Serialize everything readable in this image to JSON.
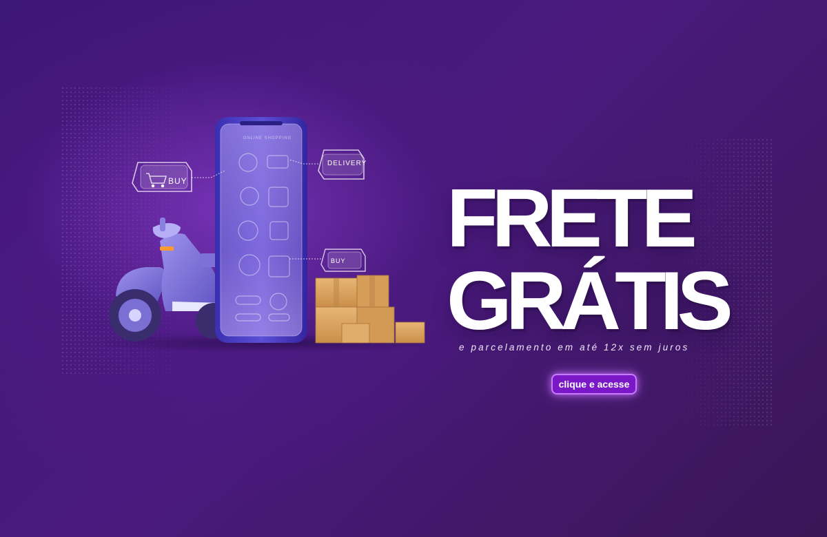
{
  "banner": {
    "headline_line1": "FRETE",
    "headline_line2": "GRÁTIS",
    "subheadline": "e parcelamento em até 12x sem juros",
    "cta_label": "clique e acesse"
  },
  "illustration": {
    "tag_buy_top": "BUY",
    "tag_delivery": "DELIVERY",
    "tag_buy_bottom": "BUY",
    "phone_heading": "ONLINE SHOPPING"
  },
  "colors": {
    "background": "#451a7e",
    "headline": "#ffffff",
    "cta_background": "#7a18c8",
    "cta_glow": "#c77bff",
    "scooter": "#7f74d6",
    "box": "#d9a45f"
  }
}
